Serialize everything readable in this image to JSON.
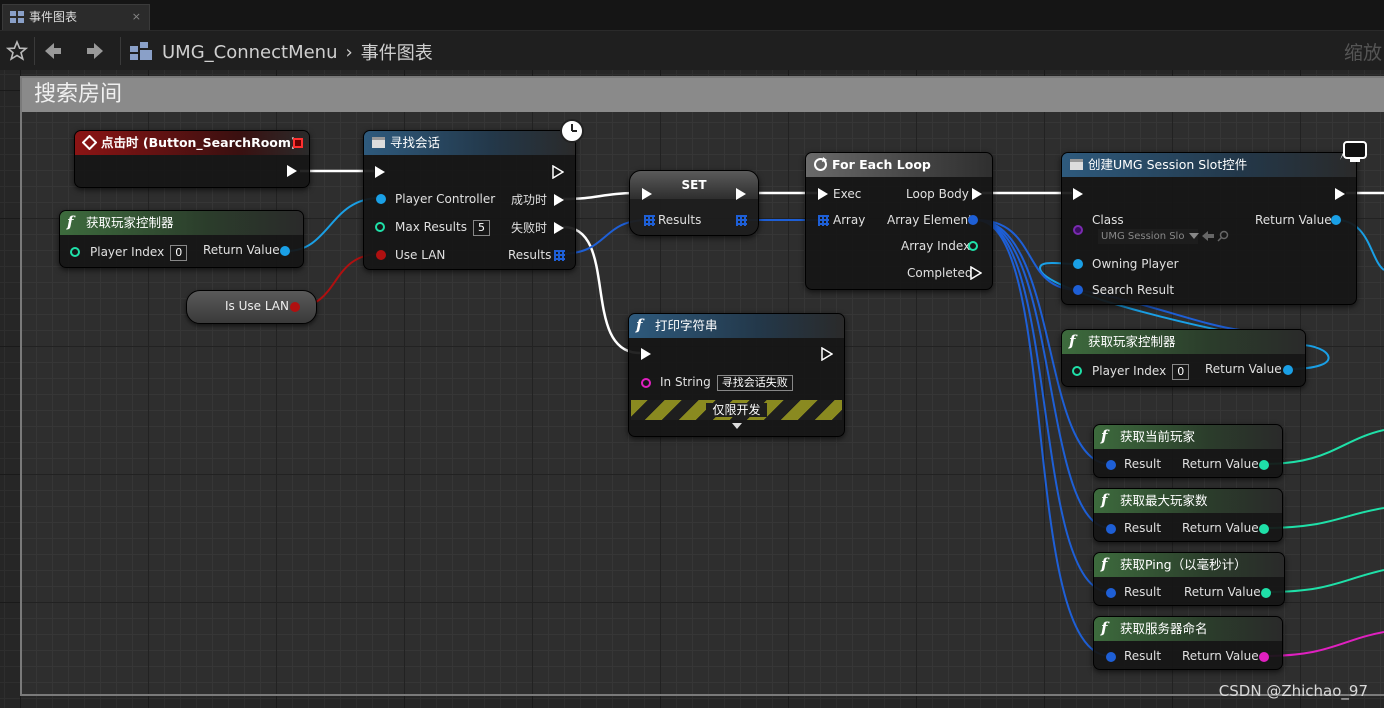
{
  "tab": {
    "title": "事件图表",
    "close": "×"
  },
  "toolbar": {
    "crumb_root": "UMG_ConnectMenu",
    "crumb_sep": "›",
    "crumb_current": "事件图表",
    "zoom": "缩放"
  },
  "comment": {
    "title": "搜索房间"
  },
  "nodes": {
    "event_click": {
      "title": "点击时 (Button_SearchRoom)"
    },
    "get_pc_1": {
      "title": "获取玩家控制器",
      "player_index_label": "Player Index",
      "player_index_value": "0",
      "return_label": "Return Value"
    },
    "is_use_lan": {
      "label": "Is Use LAN"
    },
    "find_session": {
      "title": "寻找会话",
      "player_controller": "Player Controller",
      "max_results": "Max Results",
      "max_results_value": "5",
      "use_lan": "Use LAN",
      "on_success": "成功时",
      "on_failure": "失败时",
      "results": "Results"
    },
    "set": {
      "title": "SET",
      "results": "Results"
    },
    "print_string": {
      "title": "打印字符串",
      "in_string": "In String",
      "in_string_value": "寻找会话失败",
      "dev_only": "仅限开发"
    },
    "for_each": {
      "title": "For Each Loop",
      "exec": "Exec",
      "array": "Array",
      "loop_body": "Loop Body",
      "array_element": "Array Element",
      "array_index": "Array Index",
      "completed": "Completed"
    },
    "create_widget": {
      "title": "创建UMG Session Slot控件",
      "class": "Class",
      "class_value": "UMG Session Slo",
      "owning_player": "Owning Player",
      "search_result": "Search Result",
      "return_label": "Return Value"
    },
    "get_pc_2": {
      "title": "获取玩家控制器",
      "player_index_label": "Player Index",
      "player_index_value": "0",
      "return_label": "Return Value"
    },
    "get_current_players": {
      "title": "获取当前玩家",
      "result": "Result",
      "return_label": "Return Value"
    },
    "get_max_players": {
      "title": "获取最大玩家数",
      "result": "Result",
      "return_label": "Return Value"
    },
    "get_ping": {
      "title": "获取Ping（以毫秒计）",
      "result": "Result",
      "return_label": "Return Value"
    },
    "get_server_name": {
      "title": "获取服务器命名",
      "result": "Result",
      "return_label": "Return Value"
    }
  },
  "watermark": "CSDN @Zhichao_97",
  "colors": {
    "exec": "#ffffff",
    "object": "#1aa0e6",
    "struct": "#1e5fd6",
    "bool": "#b01010",
    "int": "#1fe0a8",
    "string": "#e020c0",
    "class": "#7a2ab0"
  }
}
